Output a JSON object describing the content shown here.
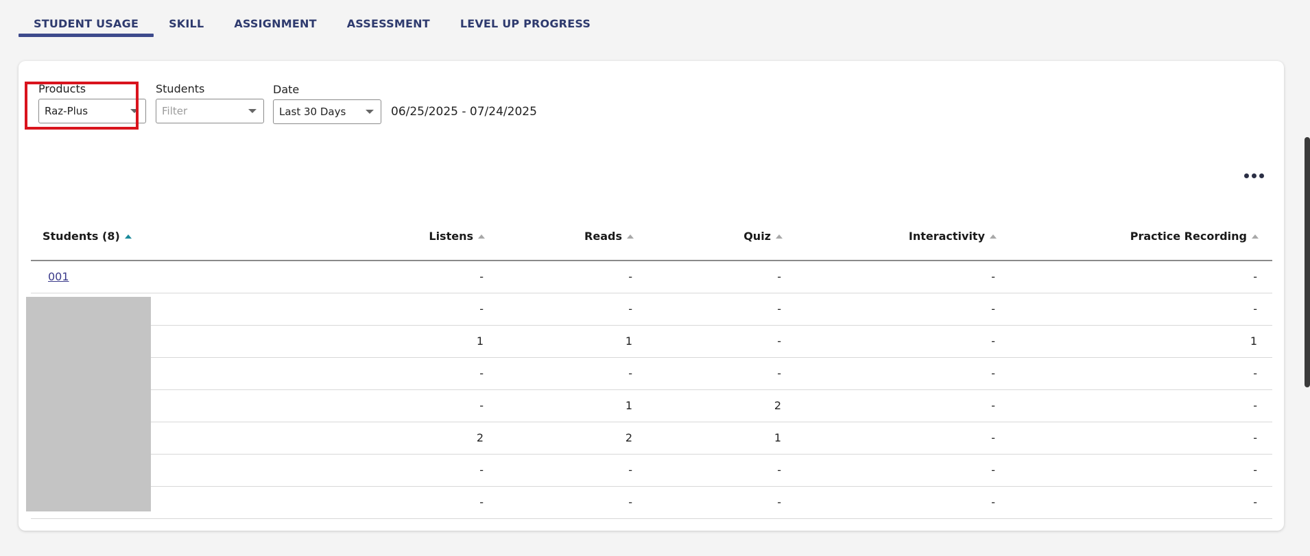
{
  "tabs": [
    {
      "label": "STUDENT USAGE",
      "active": true
    },
    {
      "label": "SKILL",
      "active": false
    },
    {
      "label": "ASSIGNMENT",
      "active": false
    },
    {
      "label": "ASSESSMENT",
      "active": false
    },
    {
      "label": "LEVEL UP PROGRESS",
      "active": false
    }
  ],
  "filters": {
    "products": {
      "label": "Products",
      "value": "Raz-Plus"
    },
    "students": {
      "label": "Students",
      "placeholder": "Filter"
    },
    "date": {
      "label": "Date",
      "value": "Last 30 Days"
    },
    "date_range": "06/25/2025 - 07/24/2025"
  },
  "table": {
    "columns": [
      "Students (8)",
      "Listens",
      "Reads",
      "Quiz",
      "Interactivity",
      "Practice Recording"
    ],
    "rows": [
      {
        "student": "001",
        "listens": "-",
        "reads": "-",
        "quiz": "-",
        "interactivity": "-",
        "practice": "-"
      },
      {
        "student": "",
        "listens": "-",
        "reads": "-",
        "quiz": "-",
        "interactivity": "-",
        "practice": "-"
      },
      {
        "student": "",
        "listens": "1",
        "reads": "1",
        "quiz": "-",
        "interactivity": "-",
        "practice": "1"
      },
      {
        "student": "",
        "listens": "-",
        "reads": "-",
        "quiz": "-",
        "interactivity": "-",
        "practice": "-"
      },
      {
        "student": "",
        "listens": "-",
        "reads": "1",
        "quiz": "2",
        "interactivity": "-",
        "practice": "-"
      },
      {
        "student": "",
        "listens": "2",
        "reads": "2",
        "quiz": "1",
        "interactivity": "-",
        "practice": "-"
      },
      {
        "student": "",
        "listens": "-",
        "reads": "-",
        "quiz": "-",
        "interactivity": "-",
        "practice": "-"
      },
      {
        "student": "",
        "listens": "-",
        "reads": "-",
        "quiz": "-",
        "interactivity": "-",
        "practice": "-"
      }
    ]
  },
  "colors": {
    "tab_text": "#2e3a6e",
    "tab_underline": "#3d4a8c",
    "highlight": "#d9141d",
    "sort_active": "#1a8a9a"
  },
  "icons": {
    "more": "more-options-icon",
    "caret": "chevron-down-icon",
    "sort": "sort-ascending-icon"
  }
}
